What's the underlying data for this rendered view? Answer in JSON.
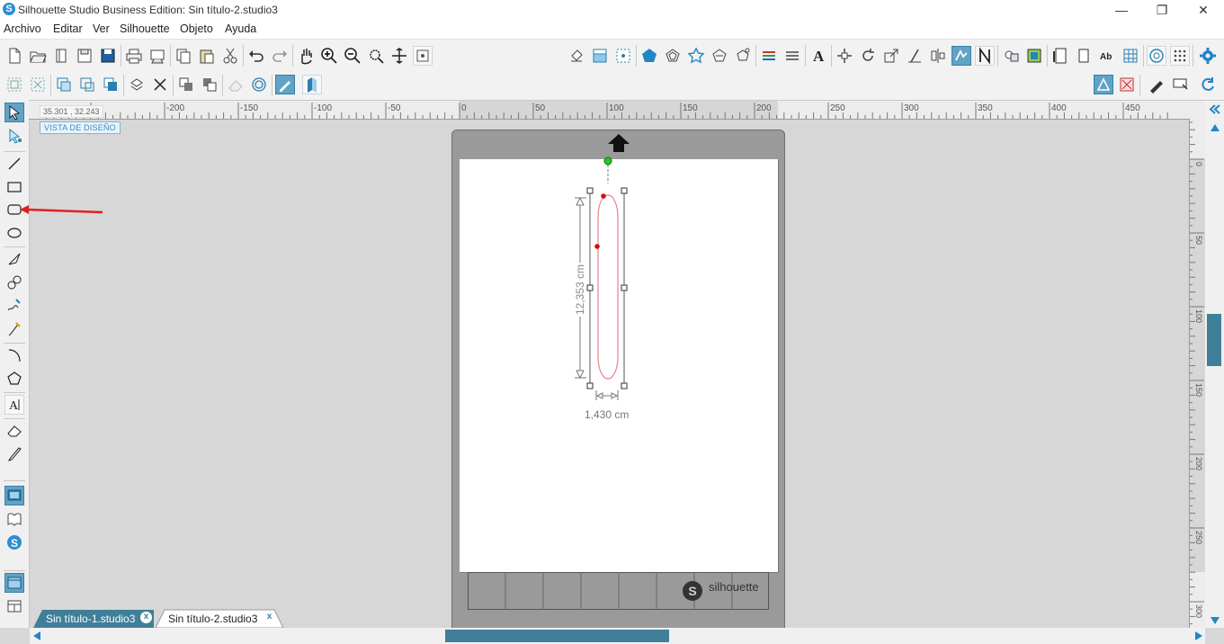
{
  "window": {
    "title": "Silhouette Studio Business Edition: Sin título-2.studio3",
    "app_icon_letter": "S",
    "controls": {
      "minimize": "—",
      "restore": "❐",
      "close": "✕"
    }
  },
  "menu": [
    "Archivo",
    "Editar",
    "Ver",
    "Silhouette",
    "Objeto",
    "Ayuda"
  ],
  "coord_readout": "35.301 , 32.243",
  "design_view_label": "VISTA DE DISEÑO",
  "hruler_labels": [
    "-200",
    "-150",
    "-100",
    "-50",
    "0",
    "50",
    "100",
    "150",
    "200",
    "250",
    "300",
    "350",
    "400",
    "450"
  ],
  "vruler_labels": [
    "0",
    "50",
    "100",
    "150",
    "200",
    "250",
    "300"
  ],
  "shape": {
    "height_label": "12,353 cm",
    "width_label": "1,430 cm"
  },
  "mat_brand": "silhouette",
  "mat_logo_letter": "S",
  "tabs": [
    {
      "label": "Sin título-1.studio3",
      "close": "x",
      "active": false
    },
    {
      "label": "Sin título-2.studio3",
      "close": "x",
      "active": true
    }
  ],
  "colors": {
    "accent": "#3a8fc0",
    "active_tool": "#5fa3c7",
    "scroll_thumb": "#3f7f98",
    "shape_stroke": "#e3868d",
    "selection_dot": "#cc1111",
    "rotate_handle": "#22cc22",
    "annotation_arrow": "#e02020"
  },
  "icons": {
    "left_tools": [
      "select-icon",
      "point-edit-icon",
      "line-icon",
      "rectangle-icon",
      "rounded-rectangle-icon",
      "ellipse-icon",
      "polygon-icon",
      "curve-icon",
      "freehand-icon",
      "smooth-freehand-icon",
      "arc-icon",
      "regular-polygon-icon",
      "text-icon",
      "eraser-icon",
      "knife-icon",
      "design-store-icon",
      "library-icon",
      "silhouette-store-icon",
      "panel-view-icon",
      "layout-view-icon"
    ]
  }
}
